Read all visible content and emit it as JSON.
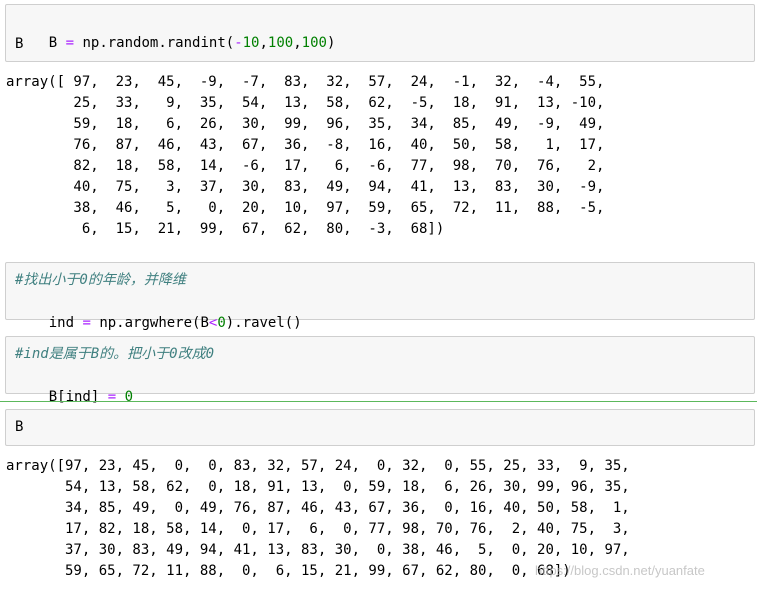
{
  "cells": [
    {
      "tokens": [
        "B",
        " ",
        "=",
        " np.random.randint(",
        "-",
        "10",
        ",",
        "100",
        ",",
        "100",
        ")"
      ],
      "line2": "B"
    },
    {
      "comment": "#找出小于0的年龄，并降维",
      "tokens": [
        "ind",
        " ",
        "=",
        " np.argwhere(B",
        "<",
        "0",
        ").ravel()"
      ]
    },
    {
      "comment": "#ind是属于B的。把小于0改成0",
      "tokens": [
        "B[ind]",
        " ",
        "=",
        " ",
        "0"
      ]
    },
    {
      "code": "B"
    }
  ],
  "outputs": [
    "array([ 97,  23,  45,  -9,  -7,  83,  32,  57,  24,  -1,  32,  -4,  55,\n        25,  33,   9,  35,  54,  13,  58,  62,  -5,  18,  91,  13, -10,\n        59,  18,   6,  26,  30,  99,  96,  35,  34,  85,  49,  -9,  49,\n        76,  87,  46,  43,  67,  36,  -8,  16,  40,  50,  58,   1,  17,\n        82,  18,  58,  14,  -6,  17,   6,  -6,  77,  98,  70,  76,   2,\n        40,  75,   3,  37,  30,  83,  49,  94,  41,  13,  83,  30,  -9,\n        38,  46,   5,   0,  20,  10,  97,  59,  65,  72,  11,  88,  -5,\n         6,  15,  21,  99,  67,  62,  80,  -3,  68])",
    "array([97, 23, 45,  0,  0, 83, 32, 57, 24,  0, 32,  0, 55, 25, 33,  9, 35,\n       54, 13, 58, 62,  0, 18, 91, 13,  0, 59, 18,  6, 26, 30, 99, 96, 35,\n       34, 85, 49,  0, 49, 76, 87, 46, 43, 67, 36,  0, 16, 40, 50, 58,  1,\n       17, 82, 18, 58, 14,  0, 17,  6,  0, 77, 98, 70, 76,  2, 40, 75,  3,\n       37, 30, 83, 49, 94, 41, 13, 83, 30,  0, 38, 46,  5,  0, 20, 10, 97,\n       59, 65, 72, 11, 88,  0,  6, 15, 21, 99, 67, 62, 80,  0, 68])"
  ],
  "watermark": "https://blog.csdn.net/yuanfate"
}
